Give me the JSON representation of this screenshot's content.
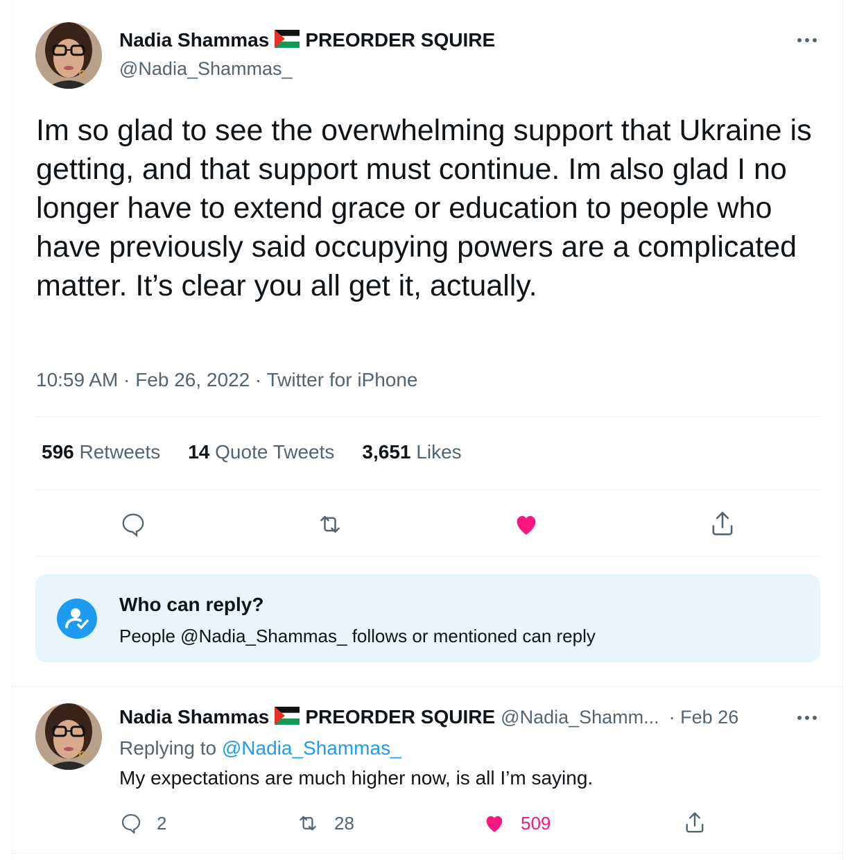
{
  "main_tweet": {
    "author_name": "Nadia Shammas",
    "author_suffix": "PREORDER SQUIRE",
    "author_handle": "@Nadia_Shammas_",
    "text": "Im so glad to see the overwhelming support that Ukraine is getting, and that support must continue. Im also glad I no longer have to extend grace or education to people who have previously said occupying powers are a complicated matter. It’s clear you all get it, actually.",
    "time": "10:59 AM",
    "date": "Feb 26, 2022",
    "source": "Twitter for iPhone",
    "retweets_count": "596",
    "retweets_label": "Retweets",
    "quotes_count": "14",
    "quotes_label": "Quote Tweets",
    "likes_count": "3,651",
    "likes_label": "Likes",
    "liked": true
  },
  "who_can_reply": {
    "title": "Who can reply?",
    "description": "People @Nadia_Shammas_ follows or mentioned can reply"
  },
  "reply_tweet": {
    "author_name": "Nadia Shammas",
    "author_suffix": "PREORDER SQUIRE",
    "author_handle": "@Nadia_Shamm...",
    "date": "· Feb 26",
    "replying_prefix": "Replying to",
    "replying_handle": "@Nadia_Shammas_",
    "text": "My expectations are much higher now, is all I’m saying.",
    "reply_count": "2",
    "retweet_count": "28",
    "like_count": "509",
    "liked": true
  },
  "colors": {
    "accent": "#1d9bf0",
    "like": "#f91880",
    "secondary_text": "#536471",
    "reply_box_bg": "#e8f5fd"
  },
  "icons": [
    "more-icon",
    "reply-icon",
    "retweet-icon",
    "like-icon",
    "share-icon",
    "who-can-reply-icon",
    "palestine-flag-icon"
  ]
}
